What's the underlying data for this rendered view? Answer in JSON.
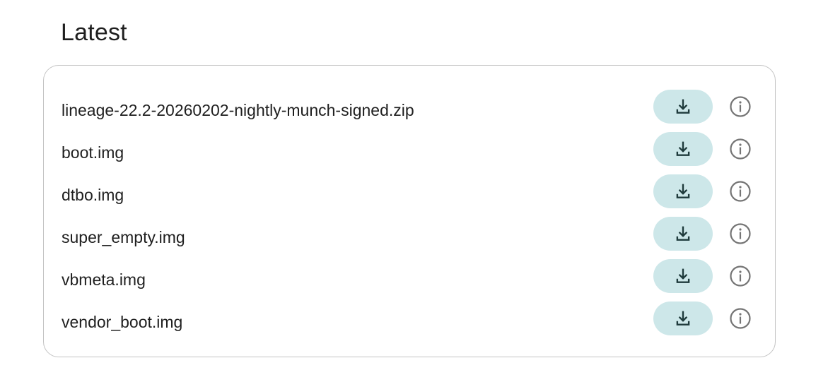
{
  "section": {
    "title": "Latest"
  },
  "files": [
    {
      "name": "lineage-22.2-20260202-nightly-munch-signed.zip"
    },
    {
      "name": "boot.img"
    },
    {
      "name": "dtbo.img"
    },
    {
      "name": "super_empty.img"
    },
    {
      "name": "vbmeta.img"
    },
    {
      "name": "vendor_boot.img"
    }
  ],
  "icons": {
    "download": "download-icon",
    "info": "info-icon"
  },
  "colors": {
    "download_button_bg": "#cde7e9",
    "download_icon": "#1f3b3c",
    "info_icon": "#757575",
    "card_border": "#c4c4c4",
    "text": "#1f1f1f"
  }
}
